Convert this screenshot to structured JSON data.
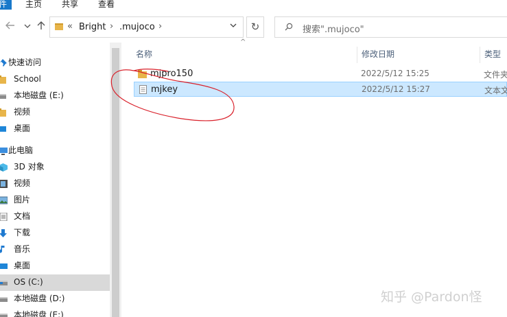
{
  "ribbon": {
    "file_label": "件",
    "tabs": [
      "主页",
      "共享",
      "查看"
    ]
  },
  "nav": {
    "back_icon": "back-arrow-icon",
    "forward_icon": "forward-arrow-icon",
    "recent_icon": "chevron-down-icon",
    "up_icon": "up-arrow-icon"
  },
  "address": {
    "overflow": "«",
    "crumbs": [
      "Bright",
      ".mujoco"
    ],
    "dropdown_icon": "chevron-down-icon",
    "refresh_icon": "refresh-icon"
  },
  "search": {
    "placeholder": "搜索\".mujoco\"",
    "icon": "search-icon"
  },
  "sidebar": {
    "items": [
      {
        "label": "快速访问",
        "icon": "pin-icon"
      },
      {
        "label": "School",
        "icon": "folder-icon"
      },
      {
        "label": "本地磁盘 (E:)",
        "icon": "drive-icon"
      },
      {
        "label": "视频",
        "icon": "folder-icon"
      },
      {
        "label": "桌面",
        "icon": "desktop-icon"
      },
      {
        "label": "此电脑",
        "icon": "computer-icon"
      },
      {
        "label": "3D 对象",
        "icon": "cube-icon"
      },
      {
        "label": "视频",
        "icon": "film-icon"
      },
      {
        "label": "图片",
        "icon": "pictures-icon"
      },
      {
        "label": "文档",
        "icon": "document-icon"
      },
      {
        "label": "下载",
        "icon": "download-icon"
      },
      {
        "label": "音乐",
        "icon": "music-icon"
      },
      {
        "label": "桌面",
        "icon": "desktop-icon"
      },
      {
        "label": "OS (C:)",
        "icon": "drive-icon",
        "selected": true
      },
      {
        "label": "本地磁盘 (D:)",
        "icon": "drive-icon"
      },
      {
        "label": "本地磁盘 (E:)",
        "icon": "drive-icon"
      }
    ]
  },
  "columns": {
    "name": "名称",
    "modified": "修改日期",
    "type": "类型"
  },
  "files": [
    {
      "name": "mjpro150",
      "modified": "2022/5/12 15:25",
      "type": "文件夹",
      "icon": "folder-icon",
      "selected": false
    },
    {
      "name": "mjkey",
      "modified": "2022/5/12 15:27",
      "type": "文本文档",
      "icon": "text-file-icon",
      "selected": true
    }
  ],
  "watermark": "知乎 @Pardon怪",
  "colors": {
    "selection": "#cce8ff",
    "selection_border": "#99d1ff",
    "annotation": "#d9202a",
    "file_tab": "#1979ca"
  }
}
